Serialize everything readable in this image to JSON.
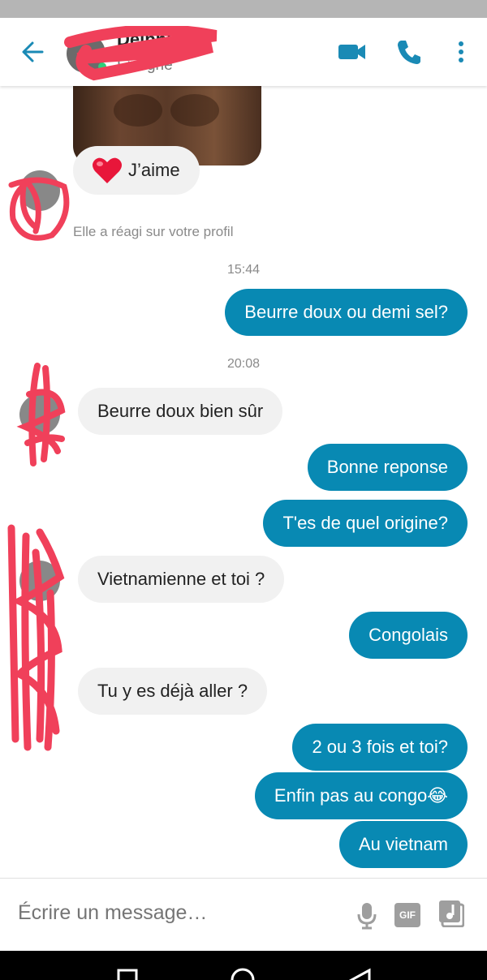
{
  "header": {
    "contact_name": "Delphine",
    "status": "En ligne",
    "back_icon": "arrow-left-icon",
    "video_icon": "video-camera-icon",
    "call_icon": "phone-icon",
    "menu_icon": "more-vertical-icon"
  },
  "reaction": {
    "label": "J’aime",
    "note": "Elle a réagi sur votre profil"
  },
  "messages": [
    {
      "kind": "time",
      "text": "15:44"
    },
    {
      "kind": "out",
      "text": "Beurre doux ou demi sel?"
    },
    {
      "kind": "time",
      "text": "20:08"
    },
    {
      "kind": "in",
      "text": "Beurre doux bien sûr"
    },
    {
      "kind": "out",
      "text": "Bonne reponse"
    },
    {
      "kind": "out",
      "text": "T'es de quel origine?"
    },
    {
      "kind": "in",
      "text": "Vietnamienne et toi ?"
    },
    {
      "kind": "out",
      "text": "Congolais"
    },
    {
      "kind": "in",
      "text": "Tu y es déjà aller ?"
    },
    {
      "kind": "out",
      "text": "2 ou 3 fois et toi?"
    },
    {
      "kind": "out",
      "text": "Enfin pas au congo😂"
    },
    {
      "kind": "out",
      "text": "Au vietnam"
    }
  ],
  "composer": {
    "placeholder": "Écrire un message…",
    "gif_label": "GIF"
  },
  "colors": {
    "accent": "#0889b3",
    "incoming_bubble": "#f1f1f1",
    "redaction": "#f0405a"
  }
}
